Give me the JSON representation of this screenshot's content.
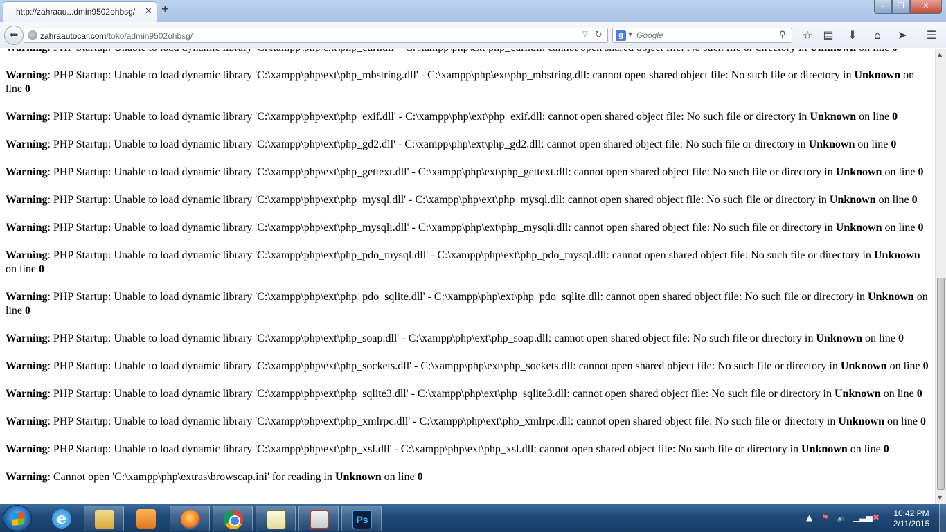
{
  "browser": {
    "tab_title": "http://zahraau...dmin9502ohbsg/",
    "tab_close": "✕",
    "new_tab": "+",
    "url_host": "zahraautocar.com",
    "url_path": "/toko/admin9502ohbsg/",
    "search_placeholder": "Google",
    "icons": [
      "back-arrow-icon",
      "site-globe-icon",
      "url-dropdown-icon",
      "reload-icon",
      "google-icon",
      "search-icon",
      "bookmark-star-icon",
      "bookmarks-menu-icon",
      "downloads-icon",
      "home-icon",
      "share-icon",
      "hamburger-menu-icon"
    ]
  },
  "window_controls": {
    "minimize": "–",
    "maximize": "❐",
    "close": "✕"
  },
  "page": {
    "warnings": [
      {
        "label": "Warning",
        "text": ": PHP Startup: Unable to load dynamic library 'C:\\xampp\\php\\ext\\php_curl.dll' - C:\\xampp\\php\\ext\\php_curl.dll: cannot open shared object file: No such file or directory in ",
        "where": "Unknown",
        "mid": " on line ",
        "line": "0"
      },
      {
        "label": "Warning",
        "text": ": PHP Startup: Unable to load dynamic library 'C:\\xampp\\php\\ext\\php_mbstring.dll' - C:\\xampp\\php\\ext\\php_mbstring.dll: cannot open shared object file: No such file or directory in ",
        "where": "Unknown",
        "mid": " on line ",
        "line": "0"
      },
      {
        "label": "Warning",
        "text": ": PHP Startup: Unable to load dynamic library 'C:\\xampp\\php\\ext\\php_exif.dll' - C:\\xampp\\php\\ext\\php_exif.dll: cannot open shared object file: No such file or directory in ",
        "where": "Unknown",
        "mid": " on line ",
        "line": "0"
      },
      {
        "label": "Warning",
        "text": ": PHP Startup: Unable to load dynamic library 'C:\\xampp\\php\\ext\\php_gd2.dll' - C:\\xampp\\php\\ext\\php_gd2.dll: cannot open shared object file: No such file or directory in ",
        "where": "Unknown",
        "mid": " on line ",
        "line": "0"
      },
      {
        "label": "Warning",
        "text": ": PHP Startup: Unable to load dynamic library 'C:\\xampp\\php\\ext\\php_gettext.dll' - C:\\xampp\\php\\ext\\php_gettext.dll: cannot open shared object file: No such file or directory in ",
        "where": "Unknown",
        "mid": " on line ",
        "line": "0"
      },
      {
        "label": "Warning",
        "text": ": PHP Startup: Unable to load dynamic library 'C:\\xampp\\php\\ext\\php_mysql.dll' - C:\\xampp\\php\\ext\\php_mysql.dll: cannot open shared object file: No such file or directory in ",
        "where": "Unknown",
        "mid": " on line ",
        "line": "0"
      },
      {
        "label": "Warning",
        "text": ": PHP Startup: Unable to load dynamic library 'C:\\xampp\\php\\ext\\php_mysqli.dll' - C:\\xampp\\php\\ext\\php_mysqli.dll: cannot open shared object file: No such file or directory in ",
        "where": "Unknown",
        "mid": " on line ",
        "line": "0"
      },
      {
        "label": "Warning",
        "text": ": PHP Startup: Unable to load dynamic library 'C:\\xampp\\php\\ext\\php_pdo_mysql.dll' - C:\\xampp\\php\\ext\\php_pdo_mysql.dll: cannot open shared object file: No such file or directory in ",
        "where": "Unknown",
        "mid": " on line ",
        "line": "0"
      },
      {
        "label": "Warning",
        "text": ": PHP Startup: Unable to load dynamic library 'C:\\xampp\\php\\ext\\php_pdo_sqlite.dll' - C:\\xampp\\php\\ext\\php_pdo_sqlite.dll: cannot open shared object file: No such file or directory in ",
        "where": "Unknown",
        "mid": " on line ",
        "line": "0"
      },
      {
        "label": "Warning",
        "text": ": PHP Startup: Unable to load dynamic library 'C:\\xampp\\php\\ext\\php_soap.dll' - C:\\xampp\\php\\ext\\php_soap.dll: cannot open shared object file: No such file or directory in ",
        "where": "Unknown",
        "mid": " on line ",
        "line": "0"
      },
      {
        "label": "Warning",
        "text": ": PHP Startup: Unable to load dynamic library 'C:\\xampp\\php\\ext\\php_sockets.dll' - C:\\xampp\\php\\ext\\php_sockets.dll: cannot open shared object file: No such file or directory in ",
        "where": "Unknown",
        "mid": " on line ",
        "line": "0"
      },
      {
        "label": "Warning",
        "text": ": PHP Startup: Unable to load dynamic library 'C:\\xampp\\php\\ext\\php_sqlite3.dll' - C:\\xampp\\php\\ext\\php_sqlite3.dll: cannot open shared object file: No such file or directory in ",
        "where": "Unknown",
        "mid": " on line ",
        "line": "0"
      },
      {
        "label": "Warning",
        "text": ": PHP Startup: Unable to load dynamic library 'C:\\xampp\\php\\ext\\php_xmlrpc.dll' - C:\\xampp\\php\\ext\\php_xmlrpc.dll: cannot open shared object file: No such file or directory in ",
        "where": "Unknown",
        "mid": " on line ",
        "line": "0"
      },
      {
        "label": "Warning",
        "text": ": PHP Startup: Unable to load dynamic library 'C:\\xampp\\php\\ext\\php_xsl.dll' - C:\\xampp\\php\\ext\\php_xsl.dll: cannot open shared object file: No such file or directory in ",
        "where": "Unknown",
        "mid": " on line ",
        "line": "0"
      },
      {
        "label": "Warning",
        "text": ": Cannot open 'C:\\xampp\\php\\extras\\browscap.ini' for reading in ",
        "where": "Unknown",
        "mid": " on line ",
        "line": "0"
      }
    ]
  },
  "taskbar": {
    "apps": [
      "internet-explorer",
      "windows-explorer",
      "media-player",
      "firefox",
      "chrome",
      "notepad",
      "keyboard-app",
      "photoshop"
    ],
    "photoshop_label": "Ps",
    "ie_label": "e",
    "tray_icons": [
      "show-hidden-icons-arrow",
      "action-center-icon",
      "volume-icon",
      "network-signal-icon",
      "power-icon"
    ],
    "time": "10:42 PM",
    "date": "2/11/2015"
  }
}
